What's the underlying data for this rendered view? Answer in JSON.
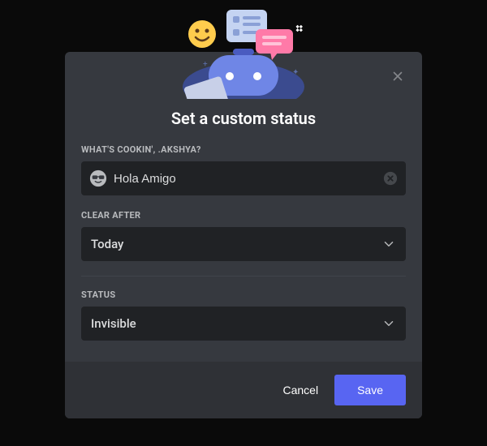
{
  "modal": {
    "title": "Set a custom status",
    "prompt_label": "WHAT'S COOKIN', .AKSHYA?",
    "status_value": "Hola Amigo",
    "clear_after_label": "CLEAR AFTER",
    "clear_after_value": "Today",
    "status_label": "STATUS",
    "status_select_value": "Invisible",
    "cancel_label": "Cancel",
    "save_label": "Save"
  },
  "colors": {
    "accent": "#5865f2",
    "input_bg": "#202225",
    "modal_bg": "#36393f",
    "footer_bg": "#2f3136"
  }
}
